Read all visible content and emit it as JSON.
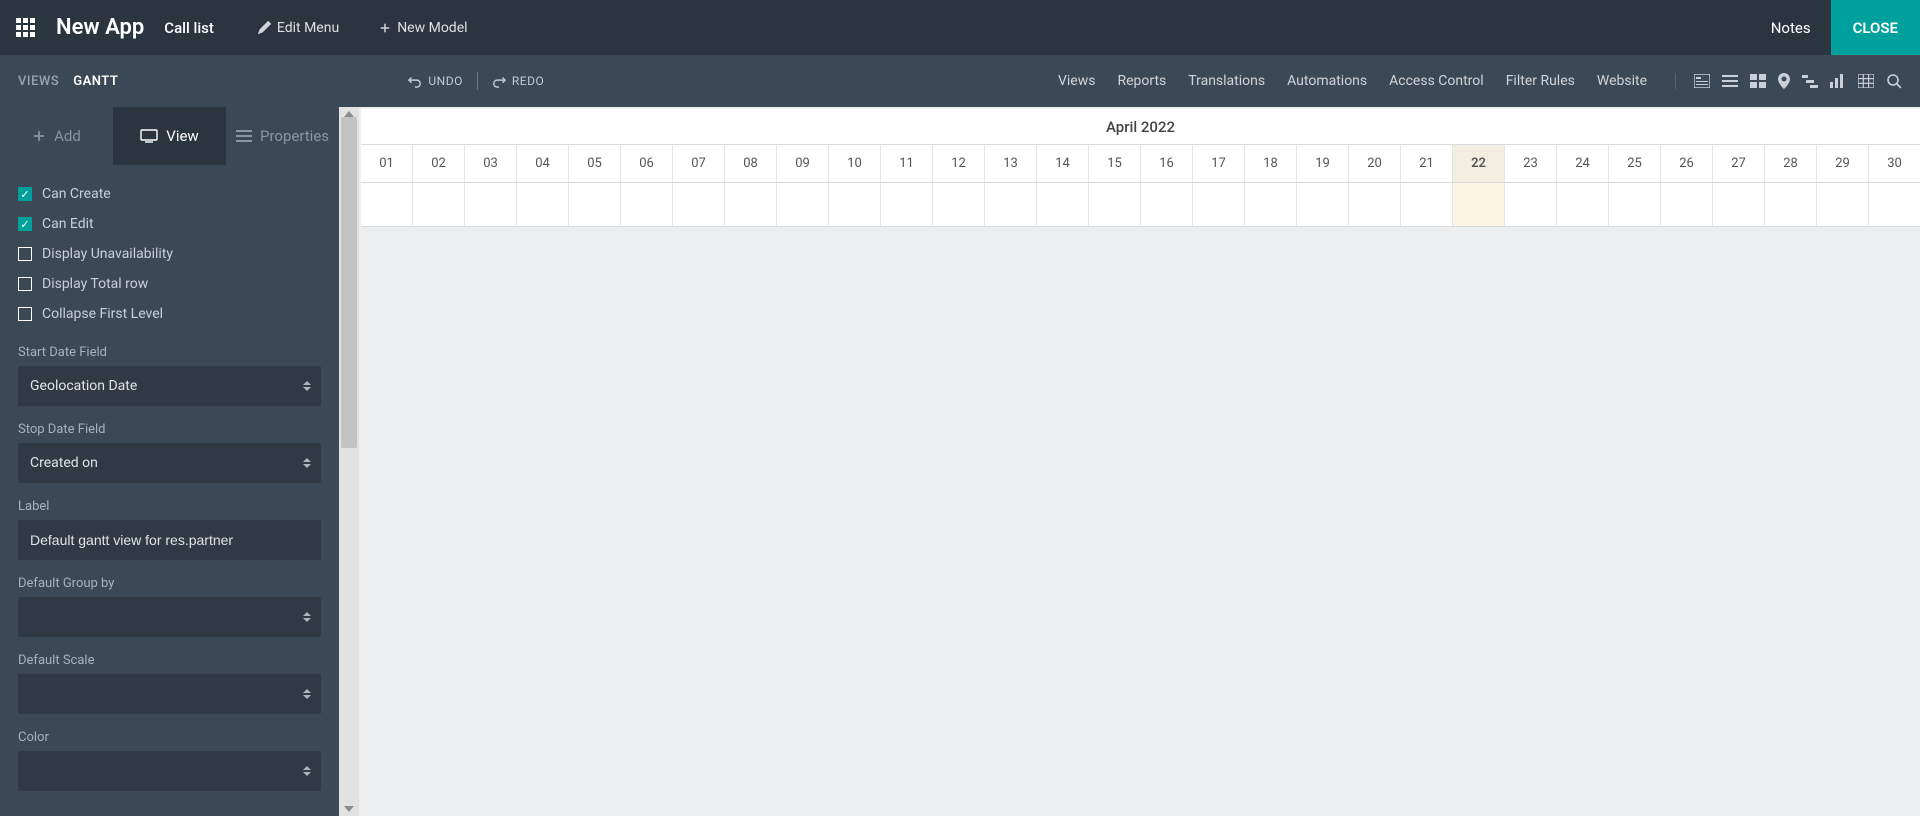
{
  "header": {
    "app_title": "New App",
    "call_list": "Call list",
    "edit_menu": "Edit Menu",
    "new_model": "New Model",
    "notes": "Notes",
    "close": "CLOSE"
  },
  "subheader": {
    "breadcrumb_views": "VIEWS",
    "breadcrumb_current": "GANTT",
    "undo": "UNDO",
    "redo": "REDO",
    "nav": {
      "views": "Views",
      "reports": "Reports",
      "translations": "Translations",
      "automations": "Automations",
      "access_control": "Access Control",
      "filter_rules": "Filter Rules",
      "website": "Website"
    }
  },
  "sidebar": {
    "tabs": {
      "add": "Add",
      "view": "View",
      "properties": "Properties"
    },
    "options": {
      "can_create": {
        "label": "Can Create",
        "checked": true
      },
      "can_edit": {
        "label": "Can Edit",
        "checked": true
      },
      "display_unavailability": {
        "label": "Display Unavailability",
        "checked": false
      },
      "display_total_row": {
        "label": "Display Total row",
        "checked": false
      },
      "collapse_first_level": {
        "label": "Collapse First Level",
        "checked": false
      }
    },
    "fields": {
      "start_date_label": "Start Date Field",
      "start_date_value": "Geolocation Date",
      "stop_date_label": "Stop Date Field",
      "stop_date_value": "Created on",
      "label_label": "Label",
      "label_value": "Default gantt view for res.partner",
      "group_by_label": "Default Group by",
      "group_by_value": "",
      "scale_label": "Default Scale",
      "scale_value": "",
      "color_label": "Color",
      "color_value": ""
    }
  },
  "gantt": {
    "title": "April 2022",
    "today": "22",
    "days": [
      "01",
      "02",
      "03",
      "04",
      "05",
      "06",
      "07",
      "08",
      "09",
      "10",
      "11",
      "12",
      "13",
      "14",
      "15",
      "16",
      "17",
      "18",
      "19",
      "20",
      "21",
      "22",
      "23",
      "24",
      "25",
      "26",
      "27",
      "28",
      "29",
      "30"
    ]
  }
}
